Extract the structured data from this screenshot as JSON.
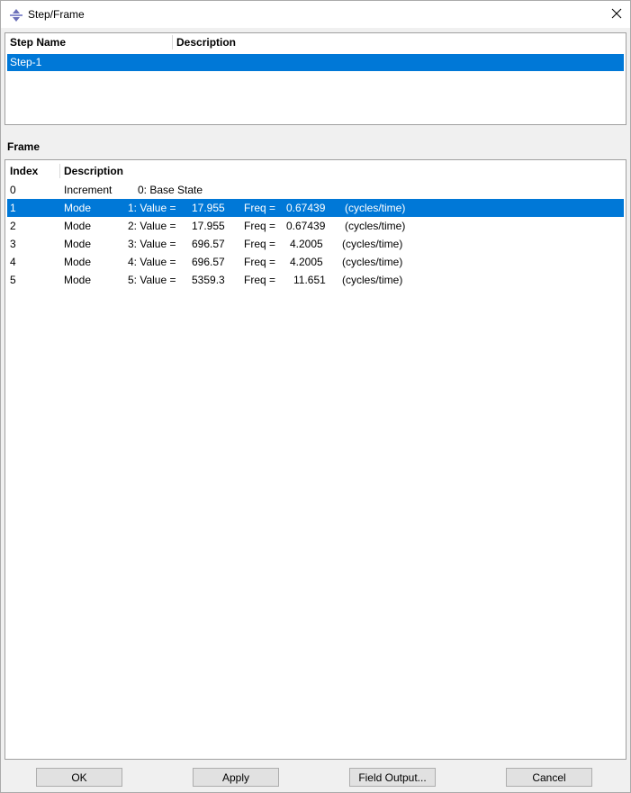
{
  "window": {
    "title": "Step/Frame"
  },
  "step_table": {
    "columns": [
      "Step Name",
      "Description"
    ],
    "rows": [
      {
        "name": "Step-1",
        "description": "",
        "selected": true
      }
    ]
  },
  "frame_section": {
    "label": "Frame"
  },
  "frame_table": {
    "columns": [
      "Index",
      "Description"
    ],
    "rows": [
      {
        "index": "0",
        "type": "Increment",
        "detail": "0: Base State",
        "selected": false
      },
      {
        "index": "1",
        "type": "Mode",
        "mode": "1: Value =",
        "value": "17.955",
        "freq_label": "Freq =",
        "freq": "0.67439",
        "unit": "(cycles/time)",
        "selected": true
      },
      {
        "index": "2",
        "type": "Mode",
        "mode": "2: Value =",
        "value": "17.955",
        "freq_label": "Freq =",
        "freq": "0.67439",
        "unit": "(cycles/time)",
        "selected": false
      },
      {
        "index": "3",
        "type": "Mode",
        "mode": "3: Value =",
        "value": "696.57",
        "freq_label": "Freq =",
        "freq": "4.2005",
        "unit": "(cycles/time)",
        "selected": false
      },
      {
        "index": "4",
        "type": "Mode",
        "mode": "4: Value =",
        "value": "696.57",
        "freq_label": "Freq =",
        "freq": "4.2005",
        "unit": "(cycles/time)",
        "selected": false
      },
      {
        "index": "5",
        "type": "Mode",
        "mode": "5: Value =",
        "value": "5359.3",
        "freq_label": "Freq =",
        "freq": "11.651",
        "unit": "(cycles/time)",
        "selected": false
      }
    ]
  },
  "buttons": {
    "ok": "OK",
    "apply": "Apply",
    "field_output": "Field Output...",
    "cancel": "Cancel"
  }
}
